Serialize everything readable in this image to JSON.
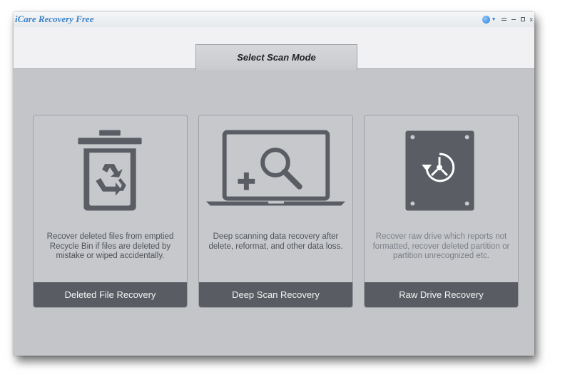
{
  "window": {
    "title": "iCare Recovery Free"
  },
  "titlebar": {
    "icons": [
      "globe-icon",
      "menu-icon",
      "minimize-icon",
      "maximize-icon",
      "close-icon"
    ],
    "close_glyph": "x"
  },
  "header": {
    "tab_label": "Select Scan Mode"
  },
  "cards": [
    {
      "icon": "recycle-bin-icon",
      "description": "Recover deleted files from emptied Recycle Bin if files are deleted by mistake or wiped accidentally.",
      "button_label": "Deleted File Recovery"
    },
    {
      "icon": "laptop-magnifier-icon",
      "description": "Deep scanning data recovery after delete, reformat, and other data loss.",
      "button_label": "Deep Scan Recovery"
    },
    {
      "icon": "raw-drive-icon",
      "description": "Recover raw drive which reports not formatted, recover deleted partition or partition unrecognized etc.",
      "button_label": "Raw Drive Recovery"
    }
  ],
  "colors": {
    "panel_bg": "#c3c5c9",
    "header_bg": "#f1f1f3",
    "footer_bg": "#595d63",
    "icon_color": "#5a5e64",
    "title_blue": "#3a82c8"
  }
}
